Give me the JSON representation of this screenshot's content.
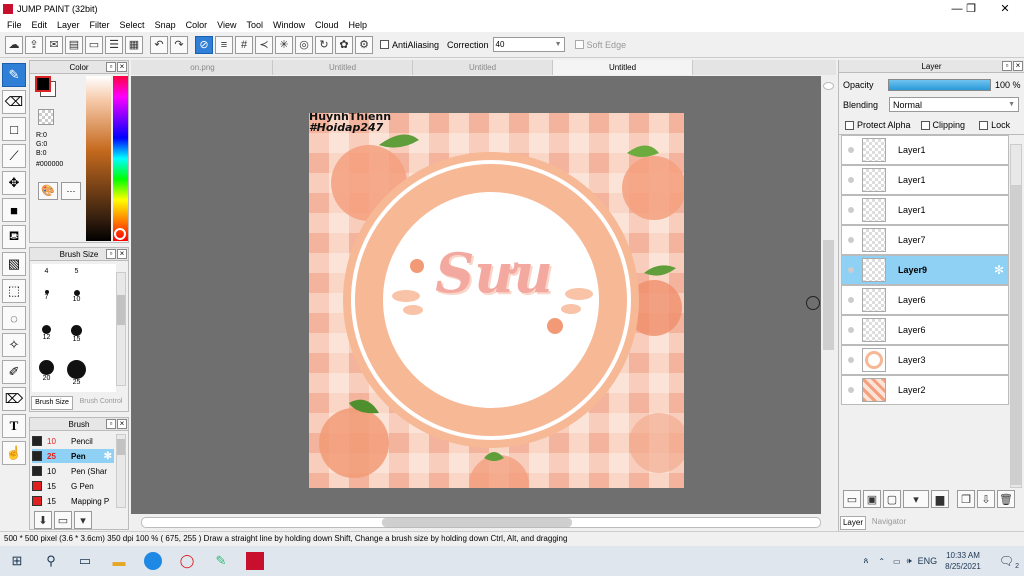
{
  "window": {
    "title": "JUMP PAINT (32bit)",
    "min": "—",
    "max": "❐",
    "close": "✕"
  },
  "menu": [
    "File",
    "Edit",
    "Layer",
    "Filter",
    "Select",
    "Snap",
    "Color",
    "View",
    "Tool",
    "Window",
    "Cloud",
    "Help"
  ],
  "toolbar": {
    "antialiasing_label": "AntiAliasing",
    "correction_label": "Correction",
    "correction_value": "40",
    "softedge_label": "Soft Edge"
  },
  "color_panel": {
    "title": "Color",
    "r": "R:0",
    "g": "G:0",
    "b": "B:0",
    "hex": "#000000",
    "foreground": "#000000",
    "background": "#ffffff"
  },
  "brush_size_panel": {
    "title": "Brush Size",
    "sizes": [
      "4",
      "5",
      "7",
      "10",
      "12",
      "15",
      "20",
      "25"
    ],
    "tab_active": "Brush Size",
    "tab_other": "Brush Control"
  },
  "brush_panel": {
    "title": "Brush",
    "items": [
      {
        "size": "10",
        "name": "Pencil",
        "color": "#222222",
        "selected": false
      },
      {
        "size": "25",
        "name": "Pen",
        "color": "#222222",
        "selected": true
      },
      {
        "size": "10",
        "name": "Pen (Shar",
        "color": "#222222",
        "selected": false
      },
      {
        "size": "15",
        "name": "G Pen",
        "color": "#e02020",
        "selected": false
      },
      {
        "size": "15",
        "name": "Mapping P",
        "color": "#e02020",
        "selected": false
      }
    ]
  },
  "tabs": [
    "on.png",
    "Untitled",
    "Untitled",
    "Untitled"
  ],
  "canvas": {
    "watermark_line1": "HuynhThienn",
    "watermark_line2": "#Hoidap247",
    "center_text": "Sưu"
  },
  "layer_panel": {
    "title": "Layer",
    "opacity_label": "Opacity",
    "opacity_value": "100 %",
    "opacity": 1.0,
    "blending_label": "Blending",
    "blending_value": "Normal",
    "protect_alpha": "Protect Alpha",
    "clipping": "Clipping",
    "lock": "Lock",
    "layers": [
      "Layer1",
      "Layer1",
      "Layer1",
      "Layer7",
      "Layer9",
      "Layer6",
      "Layer6",
      "Layer3",
      "Layer2"
    ],
    "selected_index": 4,
    "tab_active": "Layer",
    "tab_other": "Navigator"
  },
  "status": {
    "text": "500 * 500 pixel   (3.6 * 3.6cm)   350 dpi   100 %   ( 675, 255 )   Draw a straight line by holding down Shift, Change a brush size by holding down Ctrl, Alt, and dragging"
  },
  "taskbar": {
    "time": "10:33 AM",
    "date": "8/25/2021",
    "lang": "ENG",
    "notif_count": "2"
  }
}
